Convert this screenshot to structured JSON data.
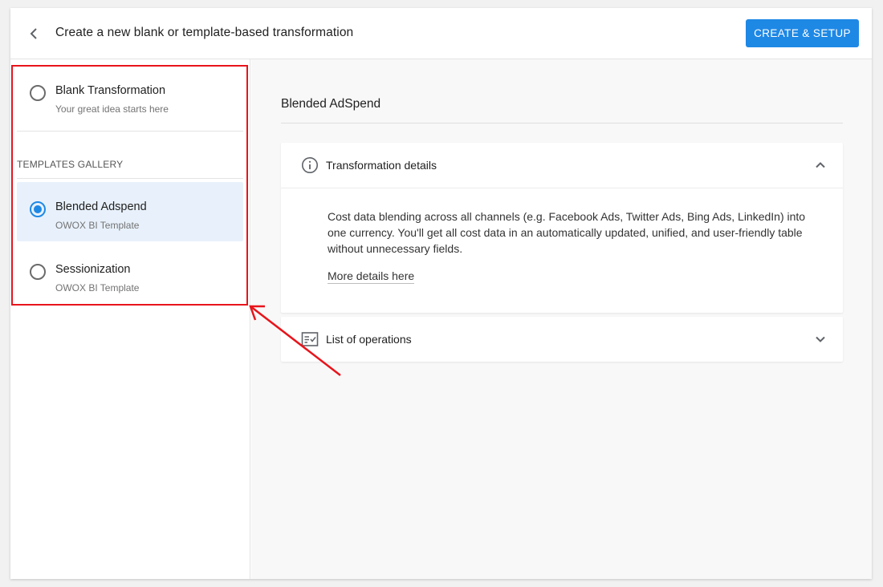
{
  "header": {
    "title": "Create a new blank or template-based transformation",
    "primary_button": "CREATE & SETUP",
    "back_icon": "chevron-left-icon"
  },
  "sidebar": {
    "blank_option": {
      "title": "Blank Transformation",
      "subtitle": "Your great idea starts here",
      "selected": false
    },
    "gallery_label": "TEMPLATES GALLERY",
    "templates": [
      {
        "title": "Blended Adspend",
        "subtitle": "OWOX BI Template",
        "selected": true
      },
      {
        "title": "Sessionization",
        "subtitle": "OWOX BI Template",
        "selected": false
      }
    ]
  },
  "main": {
    "section_title": "Blended AdSpend",
    "details_card": {
      "title": "Transformation details",
      "icon": "info-icon",
      "expanded": true,
      "description": "Cost data blending across all channels (e.g. Facebook Ads, Twitter Ads, Bing Ads, LinkedIn) into one currency. You'll get all cost data in an automatically updated, unified, and user-friendly table without unnecessary fields.",
      "link": "More details here"
    },
    "operations_card": {
      "title": "List of operations",
      "icon": "checklist-icon",
      "expanded": false
    }
  },
  "colors": {
    "accent": "#1e88e5",
    "selected_bg": "#e8f1fb",
    "annotation": "#e8141b"
  }
}
